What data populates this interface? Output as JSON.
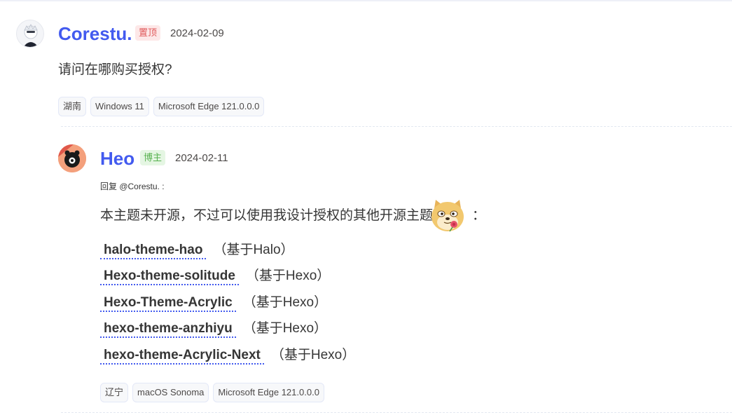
{
  "main_comment": {
    "author": "Corestu.",
    "badge": "置顶",
    "date": "2024-02-09",
    "text": "请问在哪购买授权?",
    "tags": [
      "湖南",
      "Windows 11",
      "Microsoft Edge 121.0.0.0"
    ]
  },
  "reply": {
    "author": "Heo",
    "badge": "博主",
    "date": "2024-02-11",
    "reply_to": "回复 @Corestu. :",
    "text": "本主题未开源，不过可以使用我设计授权的其他开源主题",
    "colon": "：",
    "emoji_name": "doge-flower-emoji",
    "links": [
      {
        "label": "halo-theme-hao",
        "suffix": "（基于Halo）"
      },
      {
        "label": "Hexo-theme-solitude",
        "suffix": "（基于Hexo）"
      },
      {
        "label": "Hexo-Theme-Acrylic",
        "suffix": "（基于Hexo）"
      },
      {
        "label": "hexo-theme-anzhiyu",
        "suffix": "（基于Hexo）"
      },
      {
        "label": "hexo-theme-Acrylic-Next",
        "suffix": "（基于Hexo）"
      }
    ],
    "tags": [
      "辽宁",
      "macOS Sonoma",
      "Microsoft Edge 121.0.0.0"
    ]
  },
  "colors": {
    "accent": "#425aef",
    "pinned_badge": "#e0595a",
    "owner_badge": "#57b14f"
  }
}
